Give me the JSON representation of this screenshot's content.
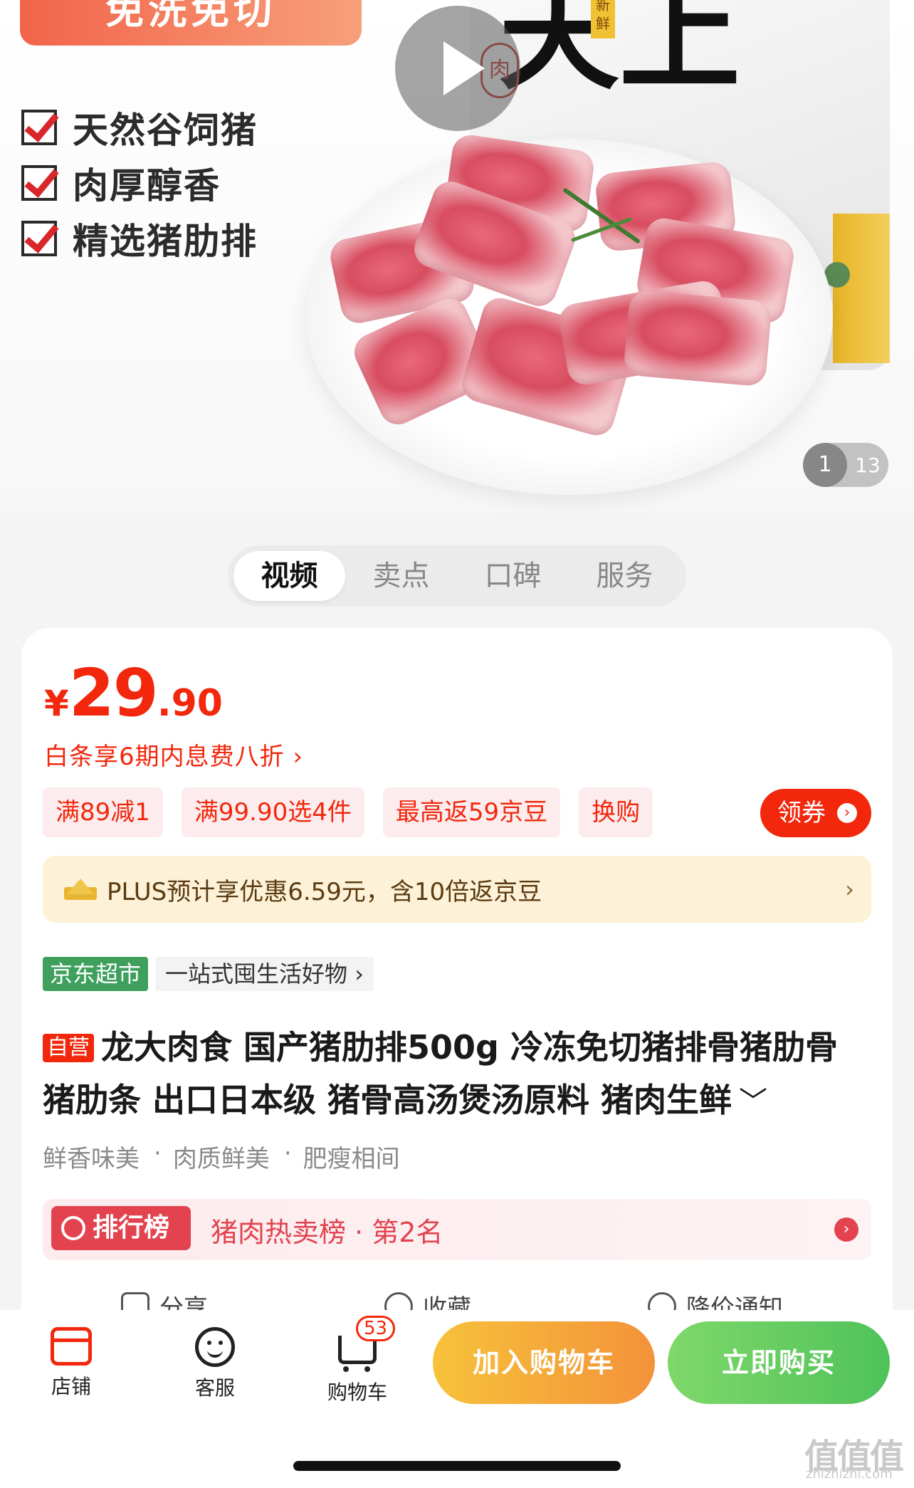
{
  "hero": {
    "banner_text": "免洗免切",
    "features": [
      "天然谷饲猪",
      "肉厚醇香",
      "精选猪肋排"
    ],
    "pack_big_text": "天上",
    "pack_seal_text": "肉",
    "pack_fresh_text": "新鲜",
    "pager_current": "1",
    "pager_total": "13",
    "play_icon": "play-icon"
  },
  "tabs": [
    {
      "label": "视频",
      "active": true
    },
    {
      "label": "卖点",
      "active": false
    },
    {
      "label": "口碑",
      "active": false
    },
    {
      "label": "服务",
      "active": false
    }
  ],
  "price": {
    "symbol": "¥",
    "integer": "29",
    "decimal": ".90",
    "color": "#f2270c"
  },
  "baitiao_text": "白条享6期内息费八折 ›",
  "promos": [
    "满89减1",
    "满99.90选4件",
    "最高返59京豆",
    "换购"
  ],
  "coupon_button": {
    "label": "领券",
    "arrow": "›"
  },
  "plus": {
    "text": "PLUS预计享优惠6.59元，含10倍返京豆",
    "arrow": "›"
  },
  "store": {
    "badge": "京东超市",
    "slogan": "一站式囤生活好物 ›"
  },
  "product": {
    "self_tag": "自营",
    "title": "龙大肉食 国产猪肋排500g 冷冻免切猪排骨猪肋骨猪肋条 出口日本级 猪骨高汤煲汤原料 猪肉生鲜",
    "chevron": "﹀"
  },
  "props": [
    "鲜香味美",
    "肉质鲜美",
    "肥瘦相间"
  ],
  "ranking": {
    "badge": "排行榜",
    "text": "猪肉热卖榜 · 第2名",
    "arrow": "›"
  },
  "actions": [
    "分享",
    "收藏",
    "降价通知"
  ],
  "bottom_nav": {
    "shop": "店铺",
    "service": "客服",
    "cart": "购物车",
    "cart_count": "53",
    "add_to_cart": "加入购物车",
    "buy_now": "立即购买"
  },
  "watermark": {
    "main": "值值值",
    "sub": "zhizhizhi.com"
  }
}
